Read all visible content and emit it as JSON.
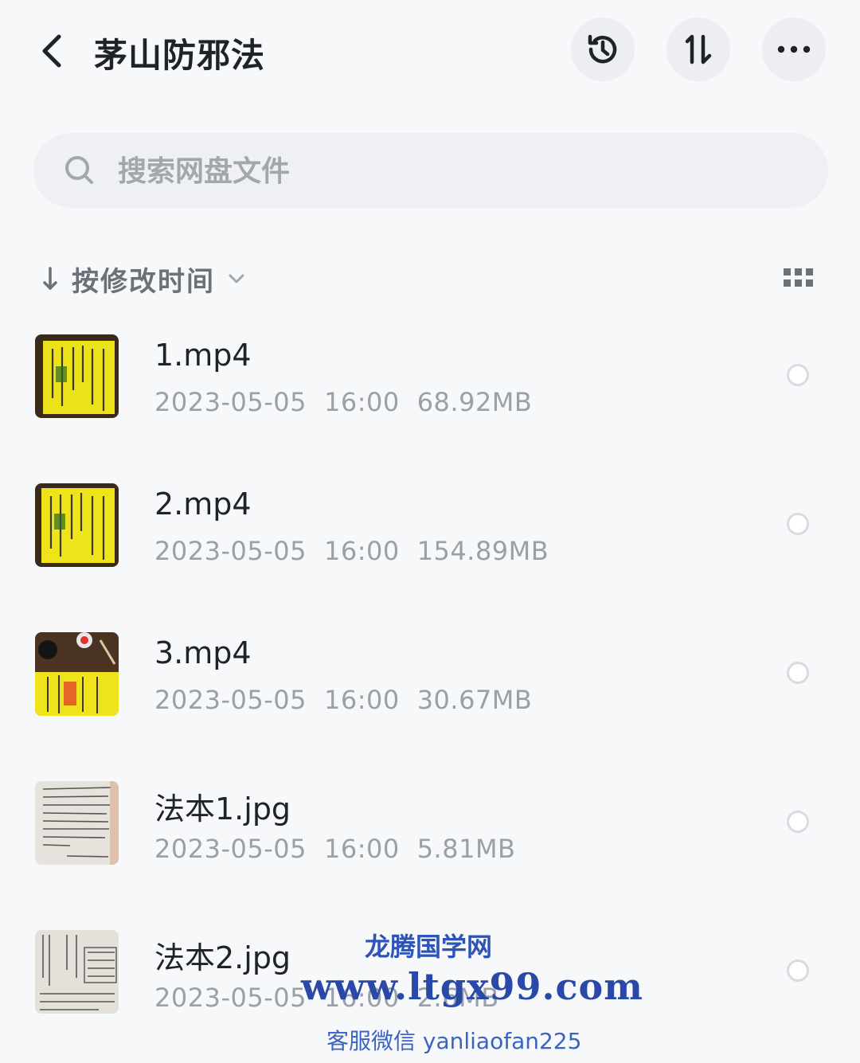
{
  "header": {
    "title": "茅山防邪法",
    "back_icon": "chevron-left-icon",
    "history_icon": "history-icon",
    "sort_icon": "sort-arrows-icon",
    "more_icon": "more-horizontal-icon"
  },
  "search": {
    "placeholder": "搜索网盘文件",
    "icon": "search-icon"
  },
  "sort_bar": {
    "label": "按修改时间",
    "direction_icon": "arrow-down-icon",
    "caret_icon": "chevron-down-icon",
    "view_toggle_icon": "grid-view-icon"
  },
  "files": [
    {
      "name": "1.mp4",
      "date": "2023-05-05",
      "time": "16:00",
      "size": "68.92MB",
      "kind": "video"
    },
    {
      "name": "2.mp4",
      "date": "2023-05-05",
      "time": "16:00",
      "size": "154.89MB",
      "kind": "video"
    },
    {
      "name": "3.mp4",
      "date": "2023-05-05",
      "time": "16:00",
      "size": "30.67MB",
      "kind": "video"
    },
    {
      "name": "法本1.jpg",
      "date": "2023-05-05",
      "time": "16:00",
      "size": "5.81MB",
      "kind": "image"
    },
    {
      "name": "法本2.jpg",
      "date": "2023-05-05",
      "time": "16:00",
      "size": "2.6MB",
      "kind": "image"
    }
  ],
  "watermark": {
    "line1": "龙腾国学网",
    "line2": "www.ltgx99.com",
    "line3": "客服微信 yanliaofan225"
  },
  "colors": {
    "background": "#f7f8fa",
    "meta_text": "#9aa0a8",
    "watermark": "#2a48a8"
  }
}
